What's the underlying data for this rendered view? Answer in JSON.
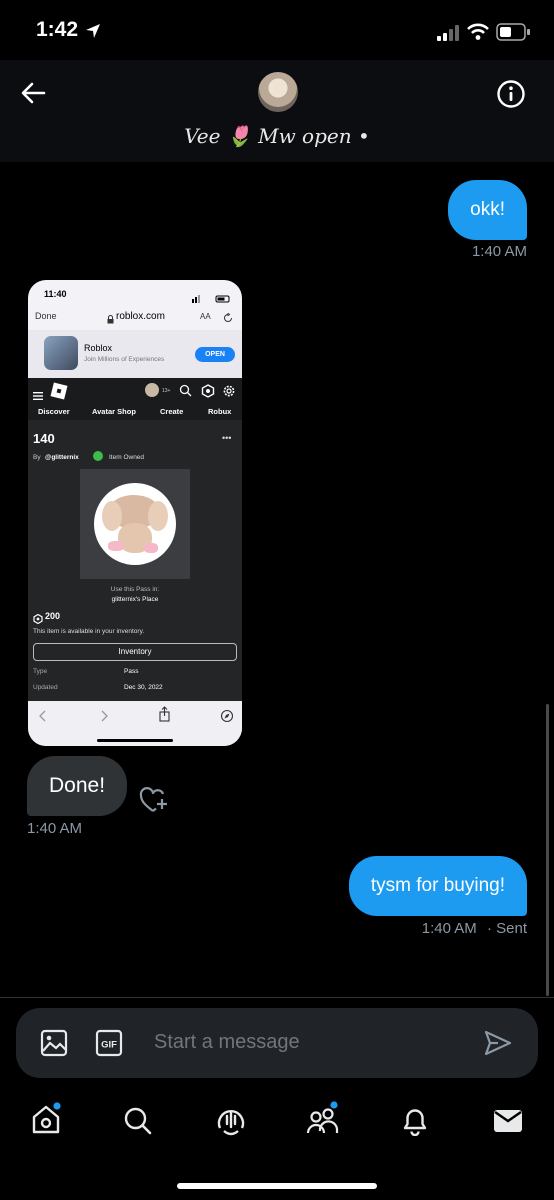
{
  "status": {
    "time": "1:42"
  },
  "header": {
    "name": "Vee 🌷 Mw open •"
  },
  "messages": [
    {
      "from": "me",
      "text": "okk!",
      "time": "1:40 AM"
    },
    {
      "from": "them",
      "text": "Done!",
      "time": "1:40 AM"
    },
    {
      "from": "me",
      "text": "tysm for buying!",
      "time": "1:40 AM",
      "status": "· Sent"
    }
  ],
  "shared_screenshot": {
    "status_time": "11:40",
    "browser": {
      "done": "Done",
      "url": "roblox.com",
      "aa": "AA"
    },
    "app_banner": {
      "title": "Roblox",
      "subtitle": "Join Millions of Experiences",
      "open": "OPEN"
    },
    "nav_tabs": [
      "Discover",
      "Avatar Shop",
      "Create",
      "Robux"
    ],
    "age_badge": "13+",
    "item": {
      "title": "140",
      "by_prefix": "By",
      "creator": "@glitternix",
      "owned": "Item Owned",
      "use_label": "Use this Pass in:",
      "place": "glitternix's Place",
      "price": "200",
      "inventory_note": "This item is available in your inventory.",
      "inventory_button": "Inventory",
      "type_label": "Type",
      "type_value": "Pass",
      "updated_label": "Updated",
      "updated_value": "Dec 30, 2022"
    }
  },
  "composer": {
    "placeholder": "Start a message"
  },
  "colors": {
    "accent": "#1d9bf0",
    "bubble_them": "#2f3336",
    "background": "#000000"
  },
  "icons": [
    "back-arrow-icon",
    "info-icon",
    "location-arrow-icon",
    "signal-icon",
    "wifi-icon",
    "battery-icon",
    "heart-plus-icon",
    "image-icon",
    "gif-icon",
    "send-icon",
    "home-icon",
    "search-icon",
    "spaces-icon",
    "communities-icon",
    "bell-icon",
    "mail-icon"
  ]
}
